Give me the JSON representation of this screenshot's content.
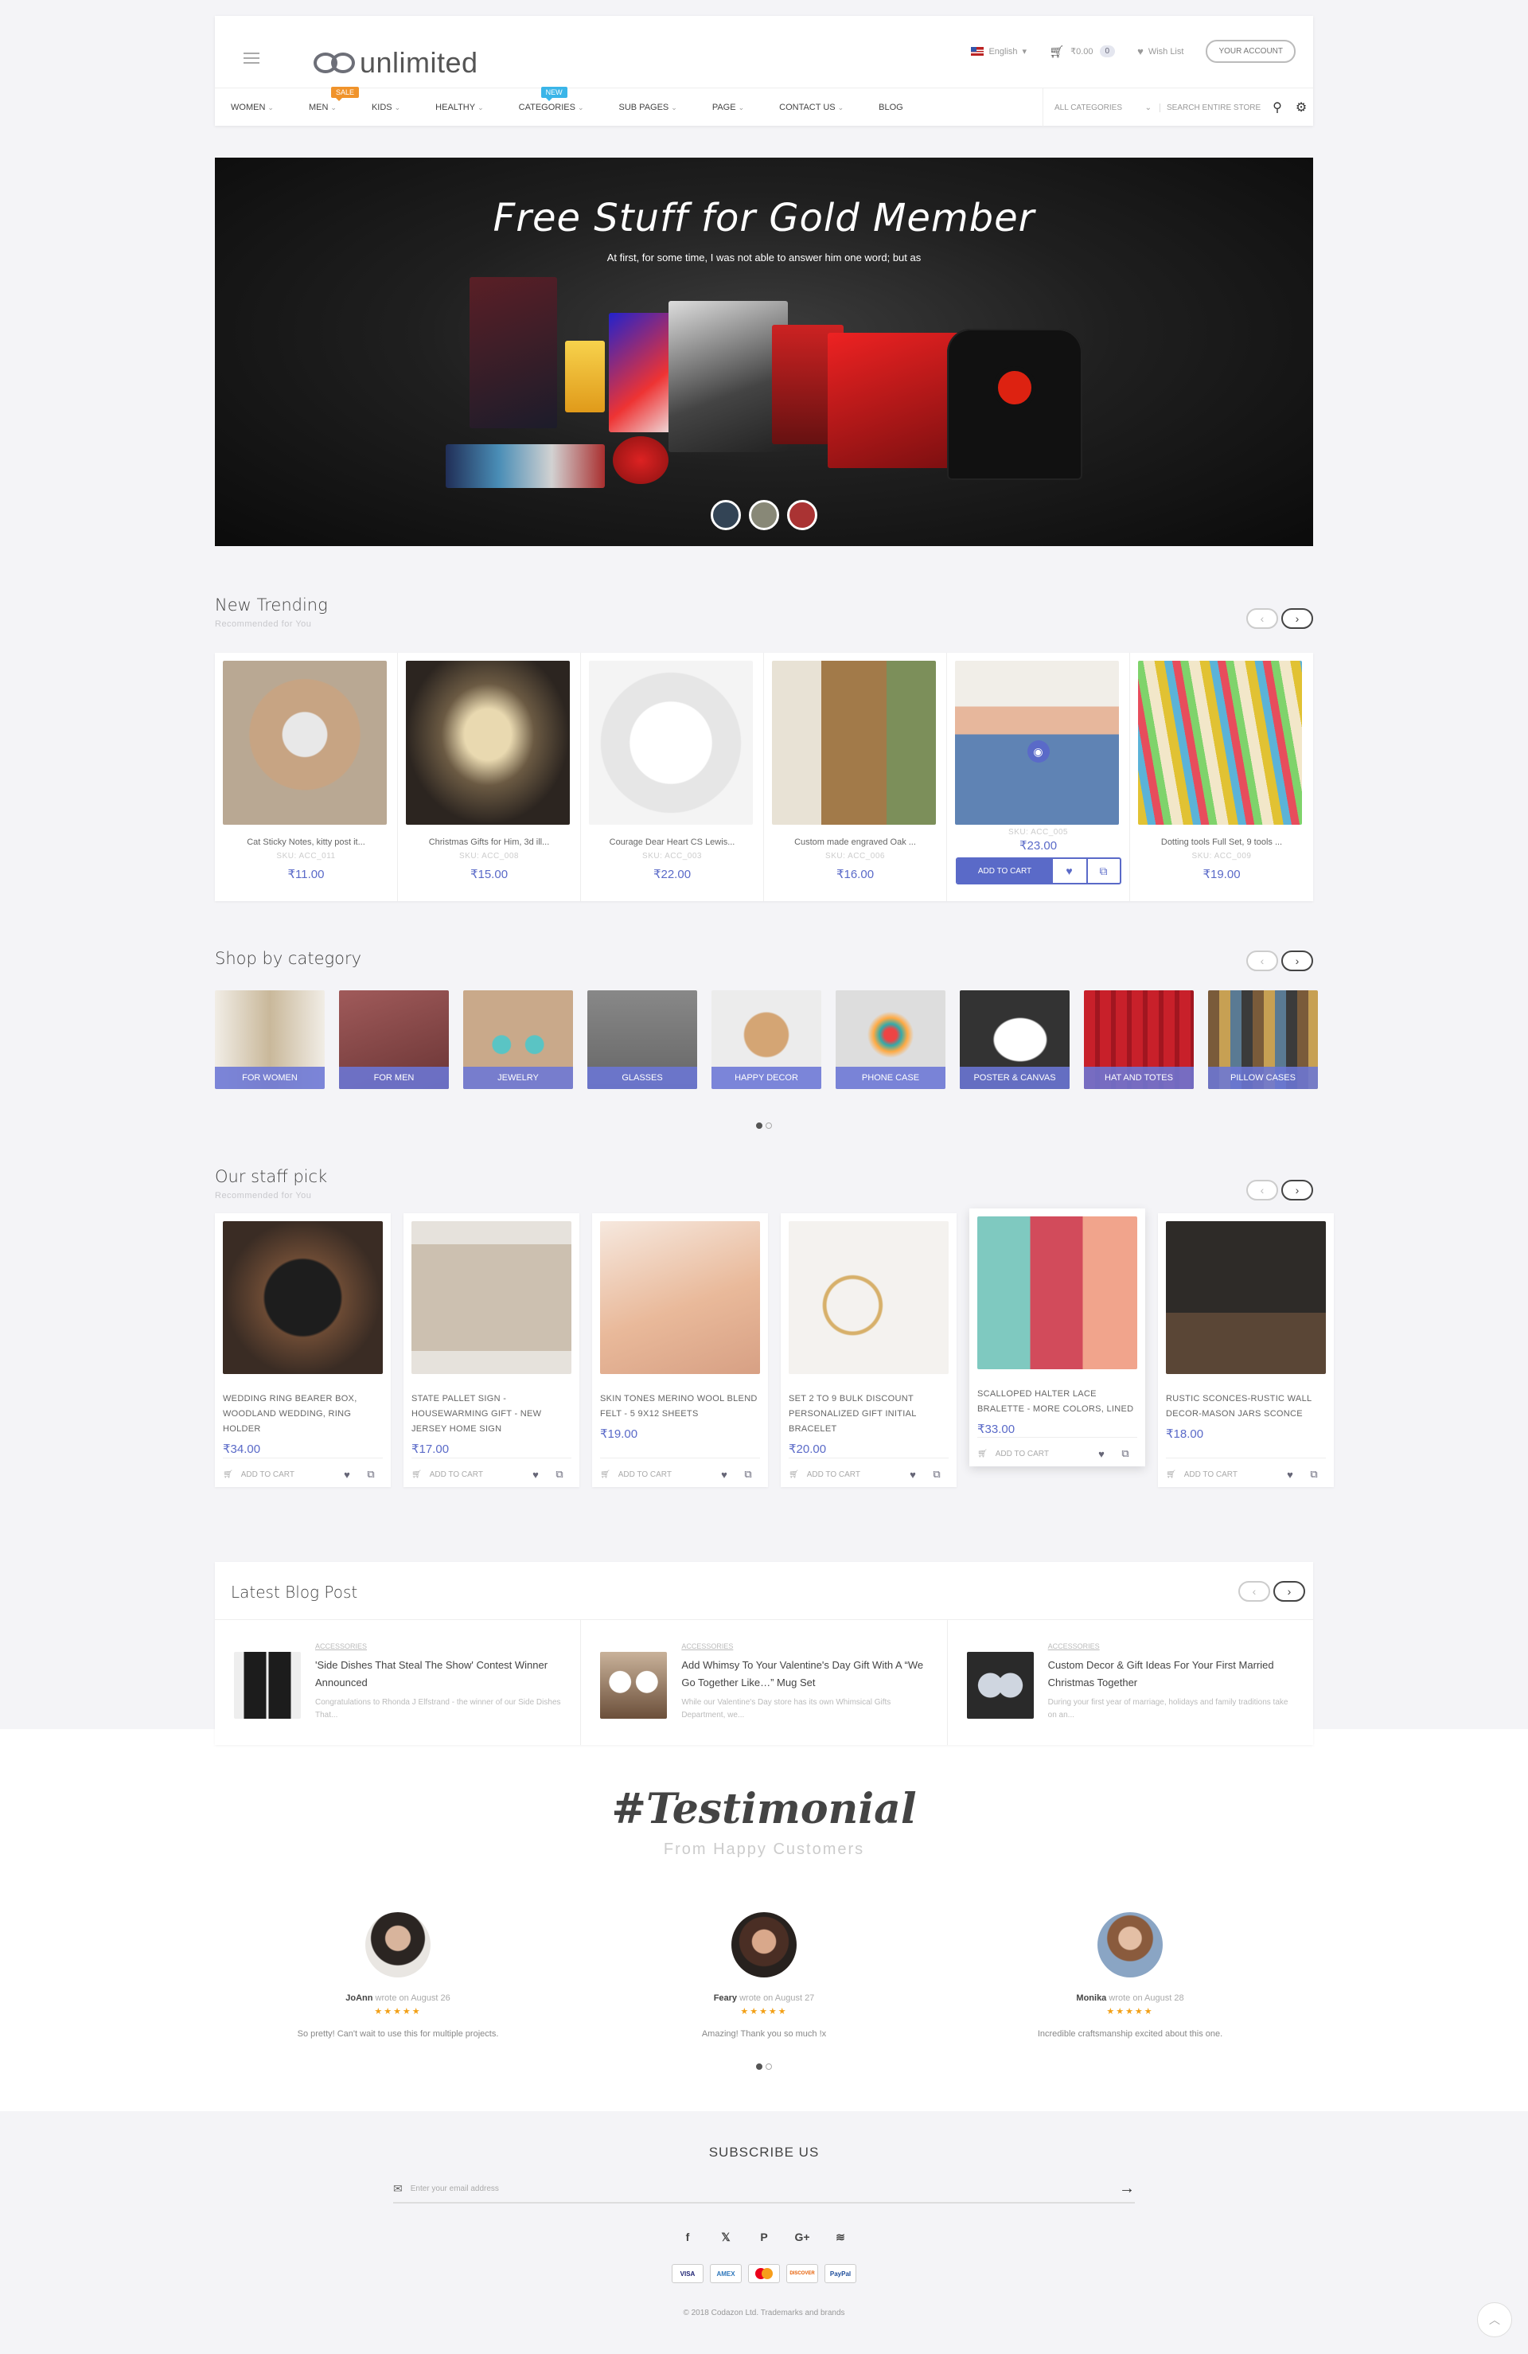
{
  "header": {
    "logo_text": "unlimited",
    "language": "English",
    "cart_total": "₹0.00",
    "cart_count": "0",
    "wishlist": "Wish List",
    "account": "Your Account"
  },
  "nav": {
    "items": [
      {
        "label": "Women",
        "tag": ""
      },
      {
        "label": "Men",
        "tag": "sale"
      },
      {
        "label": "Kids",
        "tag": ""
      },
      {
        "label": "Healthy",
        "tag": ""
      },
      {
        "label": "Categories",
        "tag": "new"
      },
      {
        "label": "Sub Pages",
        "tag": ""
      },
      {
        "label": "Page",
        "tag": ""
      },
      {
        "label": "Contact Us",
        "tag": ""
      },
      {
        "label": "Blog",
        "tag": ""
      }
    ],
    "all_categories": "All Categories",
    "search_placeholder": "Search entire store"
  },
  "hero": {
    "title": "Free Stuff for Gold Member",
    "subtitle": "At first, for some time, I was not able to answer him one word; but as"
  },
  "trending": {
    "title": "New Trending",
    "subtitle": "Recommended for You",
    "items": [
      {
        "name": "Cat Sticky Notes, kitty post it...",
        "sku": "SKU: ACC_011",
        "price": "₹11.00"
      },
      {
        "name": "Christmas Gifts for Him, 3d ill...",
        "sku": "SKU: ACC_008",
        "price": "₹15.00"
      },
      {
        "name": "Courage Dear Heart CS Lewis...",
        "sku": "SKU: ACC_003",
        "price": "₹22.00"
      },
      {
        "name": "Custom made engraved Oak ...",
        "sku": "SKU: ACC_006",
        "price": "₹16.00"
      },
      {
        "name": "",
        "sku": "SKU: ACC_005",
        "price": "₹23.00"
      },
      {
        "name": "Dotting tools Full Set, 9 tools ...",
        "sku": "SKU: ACC_009",
        "price": "₹19.00"
      }
    ],
    "add_to_cart": "Add to Cart"
  },
  "categories": {
    "title": "Shop by category",
    "items": [
      "For Women",
      "For Men",
      "Jewelry",
      "Glasses",
      "Happy Decor",
      "Phone Case",
      "Poster & Canvas",
      "Hat and Totes",
      "Pillow Cases"
    ]
  },
  "staff": {
    "title": "Our staff pick",
    "subtitle": "Recommended for You",
    "items": [
      {
        "name": "Wedding Ring Bearer Box, Woodland Wedding, Ring Holder",
        "price": "₹34.00"
      },
      {
        "name": "State Pallet Sign - Housewarming Gift - New Jersey Home Sign",
        "price": "₹17.00"
      },
      {
        "name": "Skin tones Merino Wool Blend Felt - 5 9x12 Sheets",
        "price": "₹19.00"
      },
      {
        "name": "Set 2 to 9 BULK DISCOUNT Personalized Gift Initial Bracelet",
        "price": "₹20.00"
      },
      {
        "name": "Scalloped Halter Lace Bralette - More Colors, Lined",
        "price": "₹33.00"
      },
      {
        "name": "Rustic Sconces-Rustic Wall Decor-Mason Jars Sconce",
        "price": "₹18.00"
      }
    ],
    "add_to_cart": "Add to Cart"
  },
  "blog": {
    "title": "Latest Blog Post",
    "posts": [
      {
        "category": "Accessories",
        "title": "'Side Dishes That Steal The Show' Contest Winner Announced",
        "excerpt": "Congratulations to Rhonda J Elfstrand - the winner of our Side Dishes That..."
      },
      {
        "category": "Accessories",
        "title": "Add Whimsy To Your Valentine's Day Gift With A “We Go Together Like…” Mug Set",
        "excerpt": "While our Valentine's Day store has its own Whimsical Gifts Department, we..."
      },
      {
        "category": "Accessories",
        "title": "Custom Decor & Gift Ideas For Your First Married Christmas Together",
        "excerpt": "During your first year of marriage, holidays and family traditions take on an..."
      }
    ]
  },
  "testimonial": {
    "title": "#Testimonial",
    "subtitle": "From Happy Customers",
    "wrote_on": "wrote on",
    "items": [
      {
        "name": "JoAnn",
        "date": "August 26",
        "stars": "★★★★★",
        "text": "So pretty! Can't wait to use this for multiple projects."
      },
      {
        "name": "Feary",
        "date": "August 27",
        "stars": "★★★★★",
        "text": "Amazing! Thank you so much !x"
      },
      {
        "name": "Monika",
        "date": "August 28",
        "stars": "★★★★★",
        "text": "Incredible craftsmanship excited about this one."
      }
    ]
  },
  "footer": {
    "subscribe_title": "Subscribe Us",
    "email_placeholder": "Enter your email address",
    "payments": [
      "VISA",
      "AMEX",
      "MC",
      "DISCOVER",
      "PayPal"
    ],
    "copyright": "© 2018 Codazon Ltd. Trademarks and brands"
  },
  "colors": {
    "accent": "#5a6ac8",
    "sale": "#f0932b",
    "new": "#3ab5e8",
    "stars": "#f2a017"
  }
}
